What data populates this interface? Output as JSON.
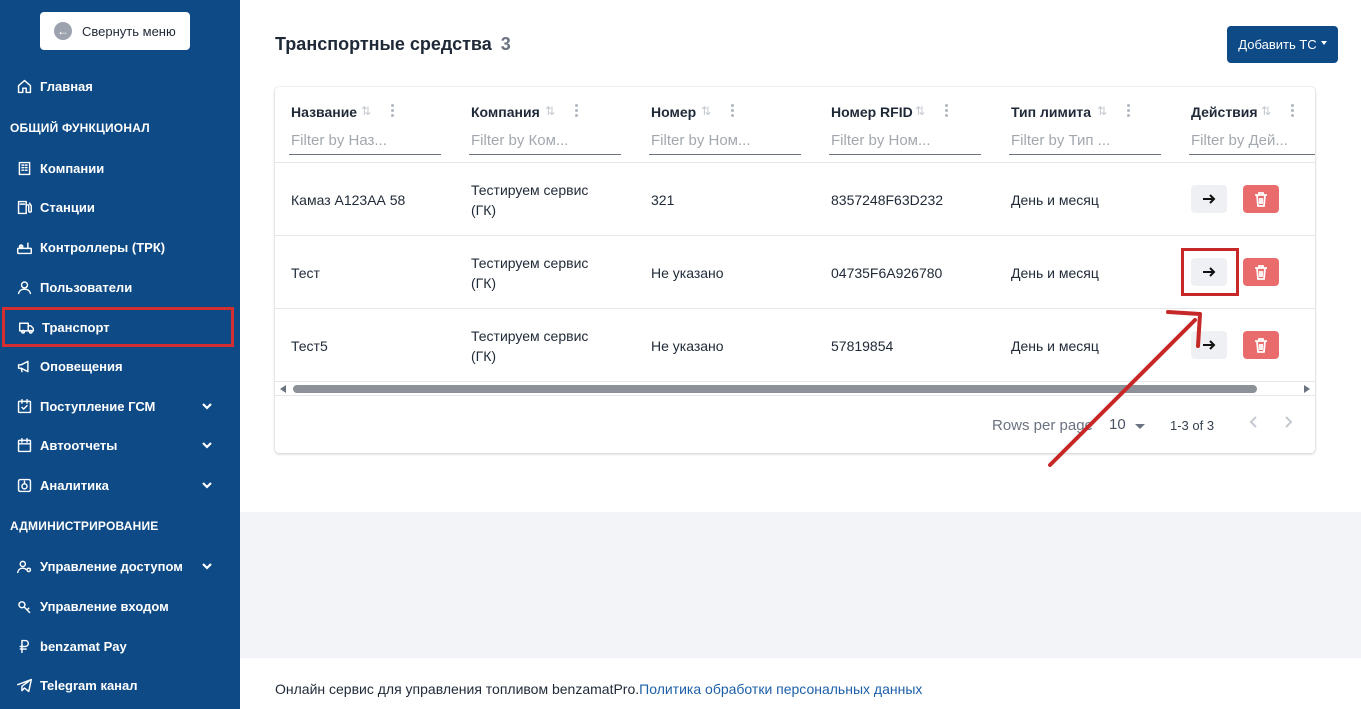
{
  "sidebar": {
    "collapse_label": "Свернуть меню",
    "home": "Главная",
    "section_general": "ОБЩИЙ ФУНКЦИОНАЛ",
    "items": [
      {
        "label": "Компании",
        "icon": "building-icon"
      },
      {
        "label": "Станции",
        "icon": "station-icon"
      },
      {
        "label": "Контроллеры (ТРК)",
        "icon": "controller-icon"
      },
      {
        "label": "Пользователи",
        "icon": "users-icon"
      },
      {
        "label": "Транспорт",
        "icon": "truck-icon"
      },
      {
        "label": "Оповещения",
        "icon": "megaphone-icon"
      },
      {
        "label": "Поступление ГСМ",
        "icon": "fuel-icon"
      },
      {
        "label": "Автоотчеты",
        "icon": "calendar-icon"
      },
      {
        "label": "Аналитика",
        "icon": "analytics-icon"
      }
    ],
    "section_admin": "АДМИНИСТРИРОВАНИЕ",
    "admin_items": [
      {
        "label": "Управление доступом",
        "icon": "access-icon"
      },
      {
        "label": "Управление входом",
        "icon": "key-icon"
      },
      {
        "label": "benzamat Pay",
        "icon": "ruble-icon"
      },
      {
        "label": "Telegram канал",
        "icon": "telegram-icon"
      }
    ]
  },
  "header": {
    "title": "Транспортные средства",
    "count": "3",
    "add_button": "Добавить ТС"
  },
  "table": {
    "columns": [
      {
        "title": "Название",
        "filter_placeholder": "Filter by Наз..."
      },
      {
        "title": "Компания",
        "filter_placeholder": "Filter by Ком..."
      },
      {
        "title": "Номер",
        "filter_placeholder": "Filter by Ном..."
      },
      {
        "title": "Номер RFID",
        "filter_placeholder": "Filter by Ном..."
      },
      {
        "title": "Тип лимита",
        "filter_placeholder": "Filter by Тип ..."
      },
      {
        "title": "Действия",
        "filter_placeholder": "Filter by Дей..."
      }
    ],
    "rows": [
      {
        "name": "Камаз А123АА 58",
        "company_line1": "Тестируем сервис",
        "company_line2": "(ГК)",
        "number": "321",
        "rfid": "8357248F63D232",
        "limit": "День и месяц"
      },
      {
        "name": "Тест",
        "company_line1": "Тестируем сервис",
        "company_line2": "(ГК)",
        "number": "Не указано",
        "rfid": "04735F6A926780",
        "limit": "День и месяц"
      },
      {
        "name": "Тест5",
        "company_line1": "Тестируем сервис",
        "company_line2": "(ГК)",
        "number": "Не указано",
        "rfid": "57819854",
        "limit": "День и месяц"
      }
    ],
    "pager": {
      "rows_per_page_label": "Rows per page",
      "rows_per_page": "10",
      "range": "1-3 of 3"
    }
  },
  "footer": {
    "text": "Онлайн сервис для управления топливом benzamatPro.",
    "link": "Политика обработки персональных данных"
  },
  "colors": {
    "sidebar_bg": "#0d4a86",
    "primary": "#0d4a86",
    "delete": "#e96b6b",
    "highlight": "#c62828"
  }
}
